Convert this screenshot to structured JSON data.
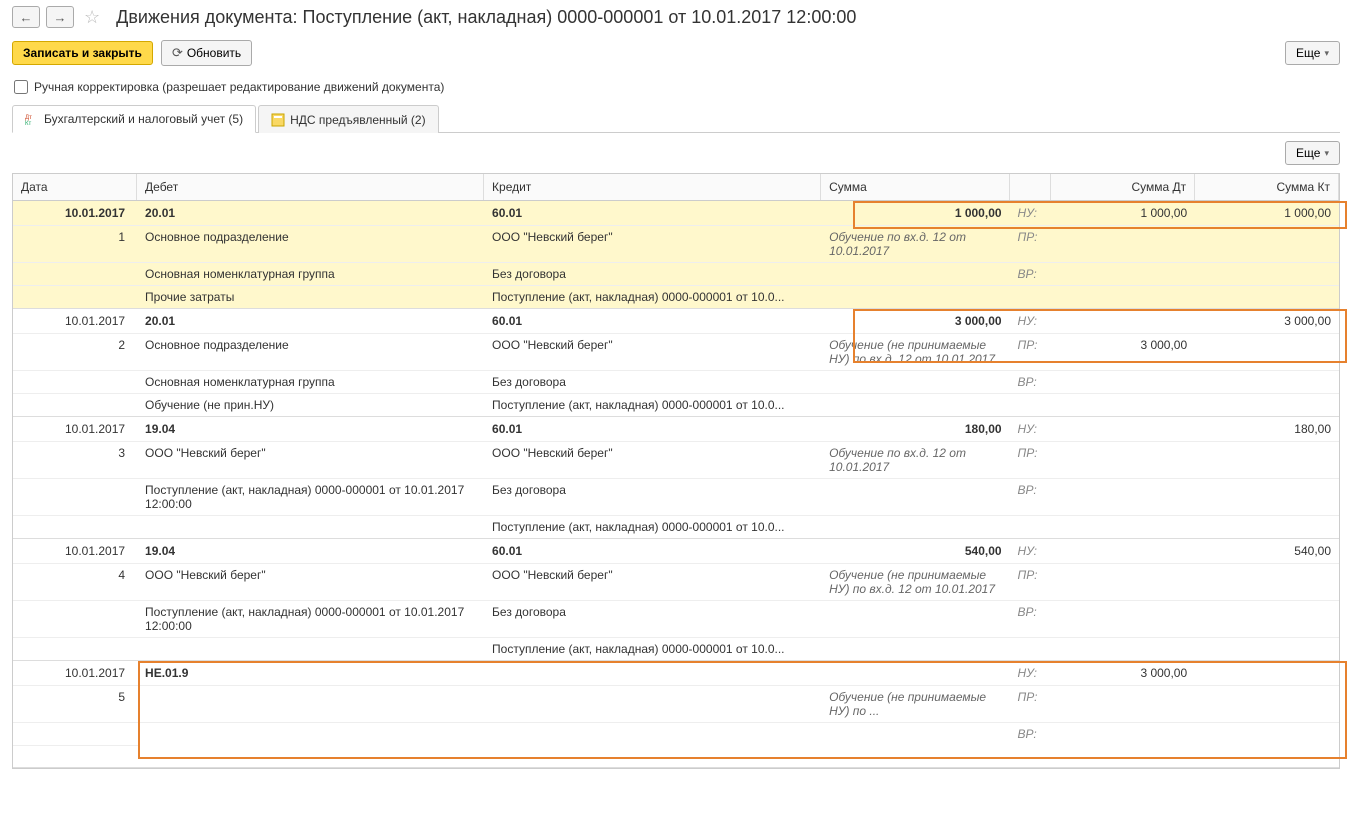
{
  "header": {
    "title": "Движения документа: Поступление (акт, накладная) 0000-000001 от 10.01.2017 12:00:00"
  },
  "actions": {
    "save_close": "Записать и закрыть",
    "refresh": "Обновить",
    "more": "Еще"
  },
  "manual_edit": {
    "label": "Ручная корректировка (разрешает редактирование движений документа)"
  },
  "tabs": {
    "accounting": "Бухгалтерский и налоговый учет (5)",
    "vat": "НДС предъявленный (2)"
  },
  "grid_more": "Еще",
  "columns": {
    "date": "Дата",
    "debit": "Дебет",
    "credit": "Кредит",
    "sum": "Сумма",
    "sum_dt": "Сумма Дт",
    "sum_kt": "Сумма Кт"
  },
  "tags": {
    "nu": "НУ:",
    "pr": "ПР:",
    "vr": "ВР:"
  },
  "entries": [
    {
      "date": "10.01.2017",
      "idx": "1",
      "debit_acc": "20.01",
      "credit_acc": "60.01",
      "sum": "1 000,00",
      "sum_dt": "1 000,00",
      "sum_kt": "1 000,00",
      "desc": "Обучение по вх.д. 12 от 10.01.2017",
      "d1": "Основное подразделение",
      "c1": "ООО \"Невский берег\"",
      "d2": "Основная номенклатурная группа",
      "c2": "Без договора",
      "d3": "Прочие затраты",
      "c3": "Поступление (акт, накладная) 0000-000001 от 10.0..."
    },
    {
      "date": "10.01.2017",
      "idx": "2",
      "debit_acc": "20.01",
      "credit_acc": "60.01",
      "sum": "3 000,00",
      "sum_dt_pr": "3 000,00",
      "sum_kt": "3 000,00",
      "desc": "Обучение (не принимаемые НУ) по вх.д. 12 от 10.01.2017",
      "d1": "Основное подразделение",
      "c1": "ООО \"Невский берег\"",
      "d2": "Основная номенклатурная группа",
      "c2": "Без договора",
      "d3": "Обучение (не прин.НУ)",
      "c3": "Поступление (акт, накладная) 0000-000001 от 10.0..."
    },
    {
      "date": "10.01.2017",
      "idx": "3",
      "debit_acc": "19.04",
      "credit_acc": "60.01",
      "sum": "180,00",
      "sum_kt": "180,00",
      "desc": "Обучение по вх.д. 12 от 10.01.2017",
      "d1": "ООО \"Невский берег\"",
      "c1": "ООО \"Невский берег\"",
      "d2": "Поступление (акт, накладная) 0000-000001 от 10.01.2017 12:00:00",
      "c2": "Без договора",
      "c3": "Поступление (акт, накладная) 0000-000001 от 10.0..."
    },
    {
      "date": "10.01.2017",
      "idx": "4",
      "debit_acc": "19.04",
      "credit_acc": "60.01",
      "sum": "540,00",
      "sum_kt": "540,00",
      "desc": "Обучение (не принимаемые НУ) по вх.д. 12 от 10.01.2017",
      "d1": "ООО \"Невский берег\"",
      "c1": "ООО \"Невский берег\"",
      "d2": "Поступление (акт, накладная) 0000-000001 от 10.01.2017 12:00:00",
      "c2": "Без договора",
      "c3": "Поступление (акт, накладная) 0000-000001 от 10.0..."
    },
    {
      "date": "10.01.2017",
      "idx": "5",
      "debit_acc": "НЕ.01.9",
      "sum_dt": "3 000,00",
      "desc": "Обучение (не принимаемые НУ) по ..."
    }
  ]
}
